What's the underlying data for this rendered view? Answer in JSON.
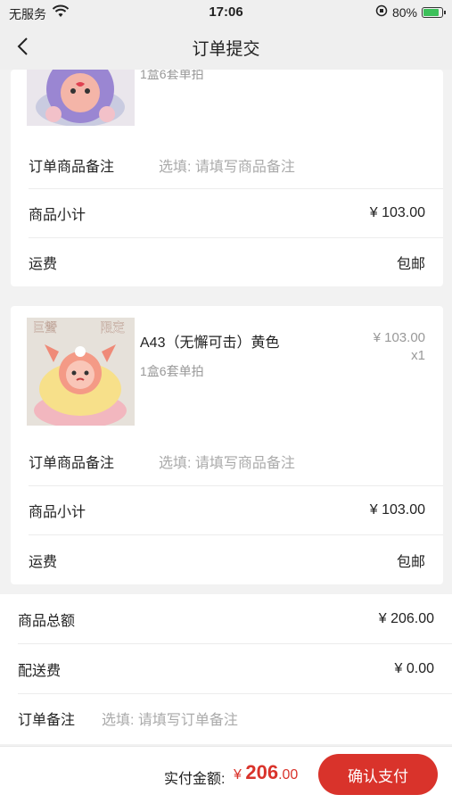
{
  "status_bar": {
    "carrier": "无服务",
    "time": "17:06",
    "battery": "80%"
  },
  "nav": {
    "title": "订单提交"
  },
  "products": [
    {
      "spec": "1盒6套单拍",
      "note_label": "订单商品备注",
      "note_placeholder": "选填: 请填写商品备注",
      "subtotal_label": "商品小计",
      "subtotal_value": "¥ 103.00",
      "shipping_label": "运费",
      "shipping_value": "包邮"
    },
    {
      "name": "A43（无懈可击）黄色",
      "spec": "1盒6套单拍",
      "price": "¥ 103.00",
      "qty": "x1",
      "image_text": [
        "巨蟹",
        "限定"
      ],
      "note_label": "订单商品备注",
      "note_placeholder": "选填: 请填写商品备注",
      "subtotal_label": "商品小计",
      "subtotal_value": "¥ 103.00",
      "shipping_label": "运费",
      "shipping_value": "包邮"
    }
  ],
  "summary": {
    "total_label": "商品总额",
    "total_value": "¥ 206.00",
    "delivery_label": "配送费",
    "delivery_value": "¥ 0.00",
    "remark_label": "订单备注",
    "remark_placeholder": "选填: 请填写订单备注"
  },
  "footer": {
    "pay_label": "实付金额:",
    "currency": "¥",
    "amount_int": "206",
    "amount_dec": ".00",
    "pay_button": "确认支付"
  },
  "colors": {
    "accent": "#d9332b",
    "background": "#f2f2f2"
  }
}
